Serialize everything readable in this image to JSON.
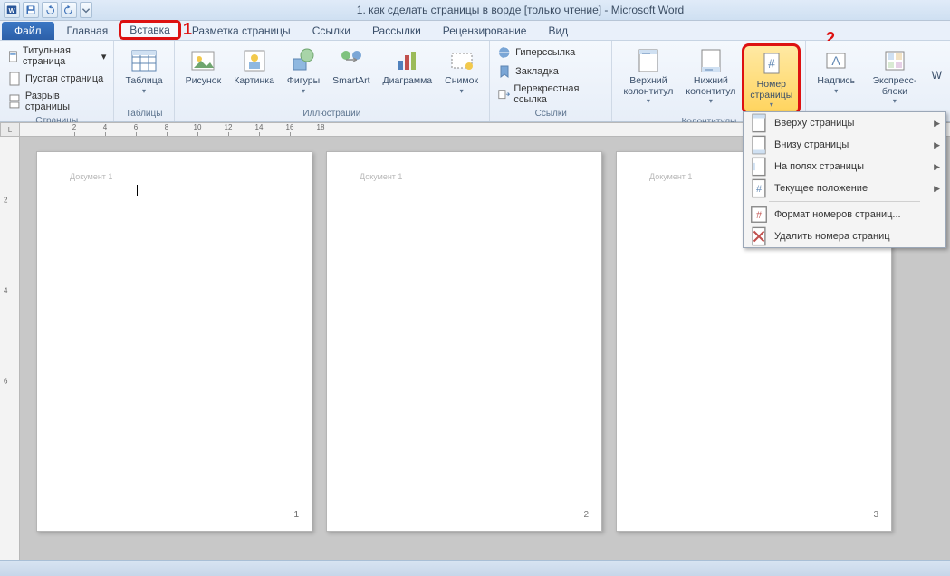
{
  "title": "1. как сделать страницы в ворде [только чтение] - Microsoft Word",
  "callouts": {
    "one": "1",
    "two": "2"
  },
  "tabs": {
    "file": "Файл",
    "items": [
      "Главная",
      "Вставка",
      "Разметка страницы",
      "Ссылки",
      "Рассылки",
      "Рецензирование",
      "Вид"
    ]
  },
  "ribbon": {
    "pages": {
      "label": "Страницы",
      "items": [
        "Титульная страница",
        "Пустая страница",
        "Разрыв страницы"
      ]
    },
    "tables": {
      "label": "Таблицы",
      "btn": "Таблица"
    },
    "illustrations": {
      "label": "Иллюстрации",
      "btns": [
        "Рисунок",
        "Картинка",
        "Фигуры",
        "SmartArt",
        "Диаграмма",
        "Снимок"
      ]
    },
    "links": {
      "label": "Ссылки",
      "items": [
        "Гиперссылка",
        "Закладка",
        "Перекрестная ссылка"
      ]
    },
    "hf": {
      "label": "Колонтитулы",
      "btns": [
        "Верхний\nколонтитул",
        "Нижний\nколонтитул",
        "Номер\nстраницы"
      ]
    },
    "text": {
      "btns": [
        "Надпись",
        "Экспресс-блоки"
      ],
      "more": "W"
    }
  },
  "menu": {
    "items": [
      "Вверху страницы",
      "Внизу страницы",
      "На полях страницы",
      "Текущее положение"
    ],
    "format": "Формат номеров страниц...",
    "remove": "Удалить номера страниц"
  },
  "pages": {
    "header": "Документ 1",
    "nums": [
      "1",
      "2",
      "3"
    ]
  },
  "ruler_nums": [
    "2",
    "4",
    "6",
    "8",
    "10",
    "12",
    "14",
    "16",
    "18"
  ],
  "vruler_nums": [
    "2",
    "4",
    "6"
  ]
}
